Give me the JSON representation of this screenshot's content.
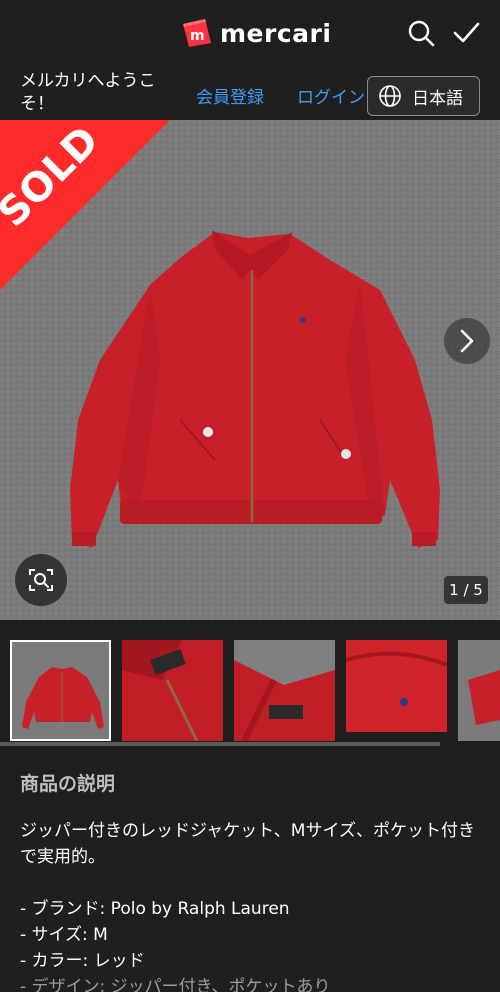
{
  "header": {
    "brand": "mercari",
    "logo_mark_letter": "m",
    "search_icon": "search-icon",
    "check_icon": "check-icon"
  },
  "subbar": {
    "welcome": "メルカリへようこそ！",
    "register": "会員登録",
    "login": "ログイン",
    "language": "日本語",
    "language_icon": "globe-icon"
  },
  "gallery": {
    "sold_label": "SOLD",
    "counter": "1 / 5",
    "next_icon": "chevron-right-icon",
    "zoom_icon": "zoom-scan-icon"
  },
  "description": {
    "title": "商品の説明",
    "intro": "ジッパー付きのレッドジャケット、Mサイズ、ポケット付きで実用的。",
    "items": [
      "- ブランド: Polo by Ralph Lauren",
      "- サイズ: M",
      "- カラー: レッド",
      "- デザイン: ジッパー付き、ポケットあり"
    ]
  },
  "colors": {
    "accent_link": "#3b9cf6",
    "sold_red": "#ff2b2b",
    "jacket_red": "#c8202a",
    "background": "#1f1f1f"
  }
}
